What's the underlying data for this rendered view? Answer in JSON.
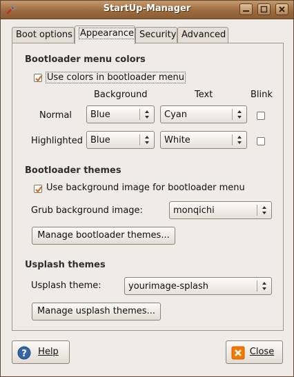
{
  "window": {
    "title": "StartUp-Manager"
  },
  "tabs": [
    "Boot options",
    "Appearance",
    "Security",
    "Advanced"
  ],
  "menu_colors": {
    "heading": "Bootloader menu colors",
    "use_colors_label": "Use colors in bootloader menu",
    "use_colors_checked": true,
    "col_background": "Background",
    "col_text": "Text",
    "col_blink": "Blink",
    "normal": {
      "label": "Normal",
      "background": "Blue",
      "text": "Cyan",
      "blink": false
    },
    "highlighted": {
      "label": "Highlighted",
      "background": "Blue",
      "text": "White",
      "blink": false
    }
  },
  "themes": {
    "heading": "Bootloader themes",
    "use_bg_label": "Use background image for bootloader menu",
    "use_bg_checked": true,
    "grub_bg_label": "Grub background image:",
    "grub_bg_value": "monqichi",
    "manage_label": "Manage bootloader themes..."
  },
  "usplash": {
    "heading": "Usplash themes",
    "theme_label": "Usplash theme:",
    "theme_value": "yourimage-splash",
    "manage_label": "Manage usplash themes..."
  },
  "footer": {
    "help_label": "Help",
    "close_label": "Close"
  },
  "colors": {
    "titlebar": "#9c6b3f",
    "checkbox_accent": "#d4691e",
    "help_icon": "#3465a4",
    "close_icon": "#f57900"
  }
}
